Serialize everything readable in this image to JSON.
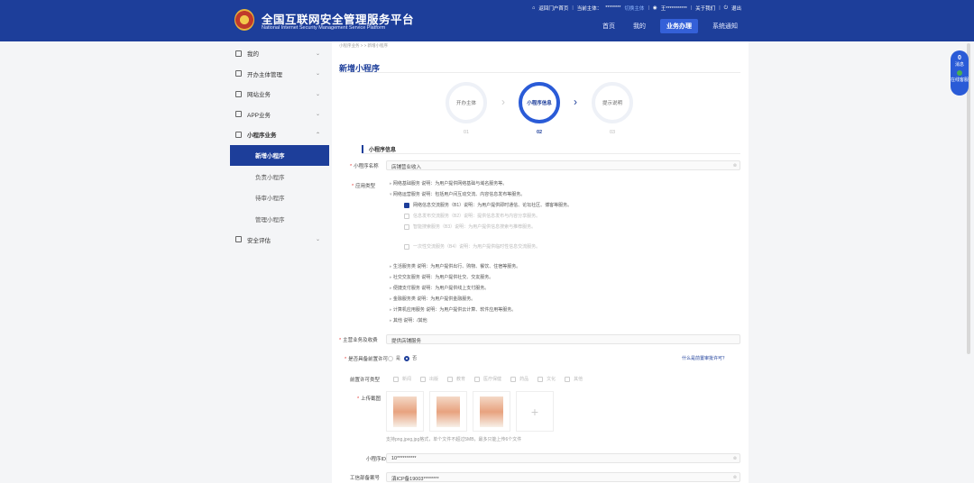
{
  "header": {
    "title": "全国互联网安全管理服务平台",
    "subtitle": "National Internet Security Management Service Platform",
    "topbar": {
      "portal": "返回门户首页",
      "subject_label": "当前主体：",
      "subject": "********",
      "switch": "切换主体",
      "user": "王***********",
      "about": "关于我们",
      "logout": "退出"
    },
    "nav": [
      "首页",
      "我的",
      "业务办理",
      "系统通知"
    ]
  },
  "sidebar": {
    "items": [
      {
        "label": "我的"
      },
      {
        "label": "开办主体管理"
      },
      {
        "label": "网站业务"
      },
      {
        "label": "APP业务"
      },
      {
        "label": "小程序业务"
      }
    ],
    "sub": [
      "新增小程序",
      "负责小程序",
      "待审小程序",
      "管理小程序"
    ],
    "last": "安全评估"
  },
  "main": {
    "breadcrumb": "小程序业务 > > 新增小程序",
    "title": "新增小程序",
    "steps": [
      {
        "label": "开办主体",
        "num": "01"
      },
      {
        "label": "小程序信息",
        "num": "02"
      },
      {
        "label": "提示说明",
        "num": "03"
      }
    ],
    "section": "小程序信息",
    "name_label": "小程序名称",
    "name_value": "店铺营业收入",
    "type_label": "应用类型",
    "tree": [
      "网络基础服务  说明：为用户提供网络基础与域名服务等。",
      "网络运营服务  说明：包括用户间互动交流、内容信息发布等服务。",
      "网络信息交流服务（B1）说明：为用户提供即时通信、论坛社区、博客等服务。",
      "信息发布交流服务（B2）说明：提供信息发布与内容分享服务。",
      "智能搜索服务（B3）说明：为用户提供信息搜索与推荐服务。",
      "一次性交流服务（B4）说明：为用户提供临时性信息交流服务。",
      "生活服务类  说明：为用户提供出行、购物、餐饮、住宿等服务。",
      "社交交友服务  说明：为用户提供社交、交友服务。",
      "便捷支付服务  说明：为用户提供线上支付服务。",
      "金融服务类  说明：为用户提供金融服务。",
      "计算机应用服务  说明：为用户提供云计算、软件应用等服务。",
      "其他  说明：/其他"
    ],
    "scope_label": "主营业务及收费",
    "scope_value": "提供店铺服务",
    "license_label": "是否具备前置许可",
    "yes": "是",
    "no": "否",
    "license_link": "什么是前置审批许可？",
    "perm_label": "前置许可类型",
    "perms": [
      "新闻",
      "出版",
      "教育",
      "医疗保健",
      "药品",
      "文化",
      "其他"
    ],
    "shot_label": "上传截图",
    "upload_tip": "支持png,jpeg,jpg格式，单个文件不超过5MB，最多只能上传6个文件",
    "id_label": "小程序ID",
    "id_value": "10**********",
    "icp_label": "工信部备案号",
    "icp_value": "滇ICP备19003********"
  },
  "float": {
    "count": "0",
    "label1": "消息",
    "label2": "在线客服"
  }
}
